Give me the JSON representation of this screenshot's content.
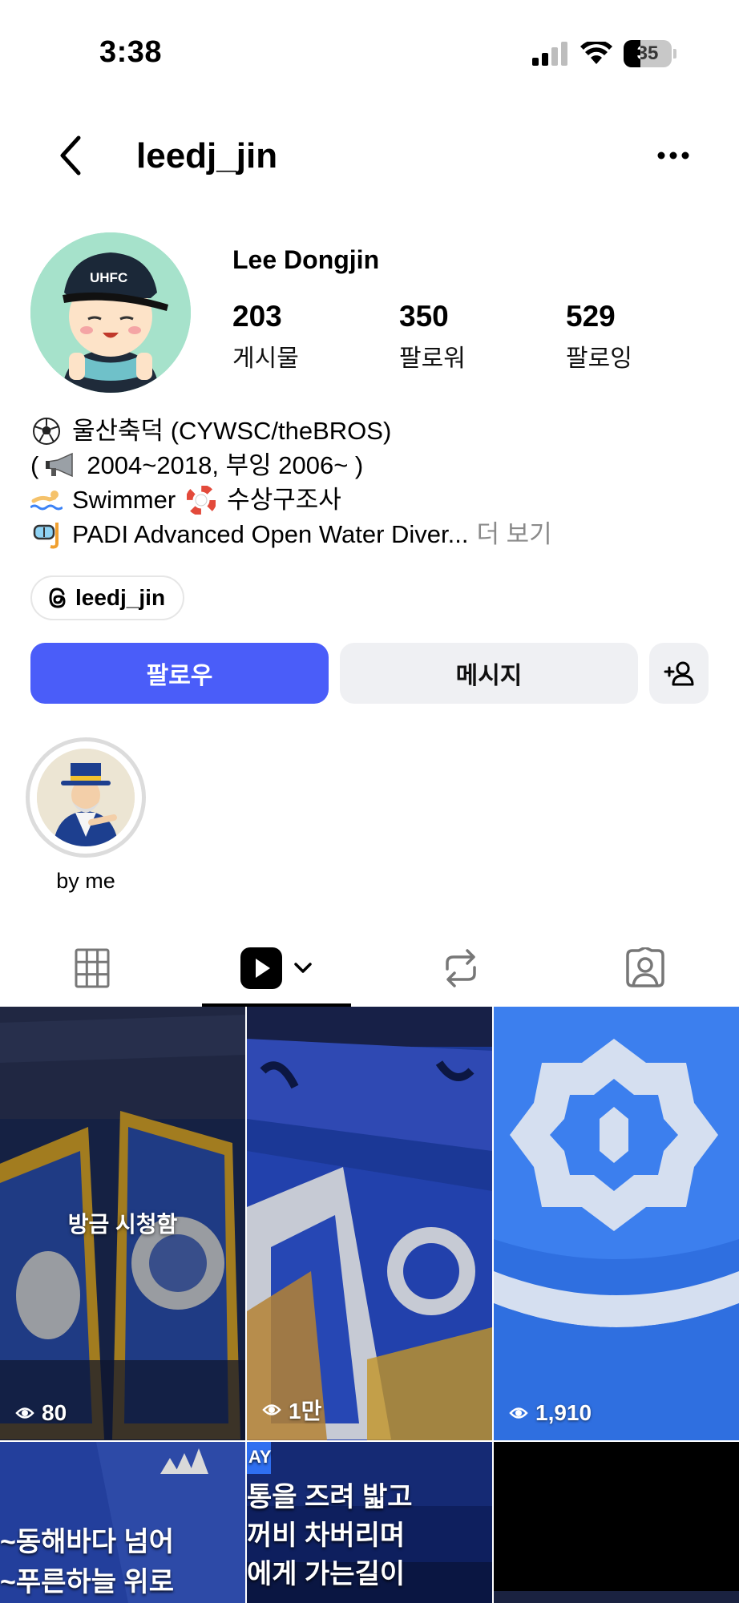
{
  "status_bar": {
    "time": "3:38",
    "battery": "35",
    "battery_level": 0.35
  },
  "header": {
    "username": "leedj_jin"
  },
  "profile": {
    "full_name": "Lee Dongjin",
    "stats": [
      {
        "value": "203",
        "label": "게시물"
      },
      {
        "value": "350",
        "label": "팔로워"
      },
      {
        "value": "529",
        "label": "팔로잉"
      }
    ]
  },
  "bio": {
    "lines": [
      {
        "icon": "soccer-ball-icon",
        "text": "울산축덕 (CYWSC/theBROS)"
      },
      {
        "icon": "megaphone-icon",
        "text": "2004~2018, 부잉 2006~ )",
        "prefix": "("
      },
      {
        "icon": "swimmer-icon",
        "text": "Swimmer",
        "icon2": "lifebuoy-icon",
        "text2": "수상구조사"
      },
      {
        "icon": "diving-mask-icon",
        "text": "PADI Advanced Open Water Diver...",
        "more": "더 보기"
      }
    ]
  },
  "threads_link": {
    "label": "leedj_jin",
    "icon": "threads-icon"
  },
  "actions": {
    "follow": "팔로우",
    "message": "메시지",
    "suggest_icon": "add-person-icon"
  },
  "highlights": [
    {
      "label": "by me"
    }
  ],
  "tabs": [
    {
      "icon": "grid-icon",
      "active": false
    },
    {
      "icon": "reels-icon",
      "active": true
    },
    {
      "icon": "reposts-icon",
      "active": false
    },
    {
      "icon": "tagged-icon",
      "active": false
    }
  ],
  "reels": [
    {
      "views": "80",
      "watched": "방금 시청함"
    },
    {
      "views": "1만"
    },
    {
      "views": "1,910"
    },
    {
      "overlay_lines": [
        "~동해바다 넘어",
        "~푸른하늘 위로"
      ]
    },
    {
      "badge": "AY",
      "overlay_lines": [
        "통을 즈려 밟고",
        "꺼비 차버리며",
        "에게 가는길이"
      ]
    },
    {}
  ]
}
